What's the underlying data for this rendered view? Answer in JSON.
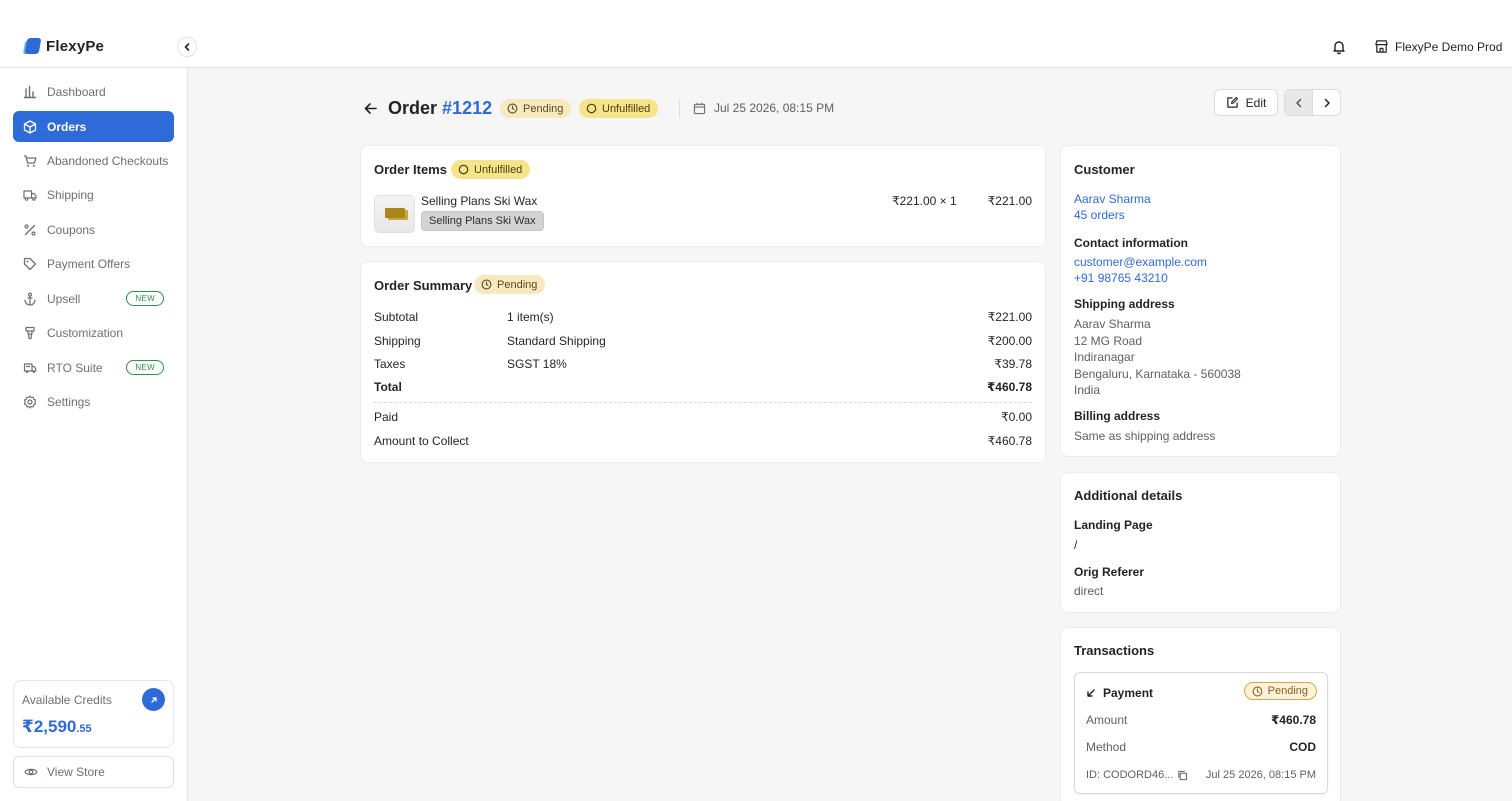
{
  "app": {
    "name": "FlexyPe",
    "store_name": "FlexyPe Demo Prod"
  },
  "sidebar": {
    "items": [
      {
        "label": "Dashboard",
        "icon": "bar-chart-icon"
      },
      {
        "label": "Orders",
        "icon": "box-icon",
        "active": true
      },
      {
        "label": "Abandoned Checkouts",
        "icon": "cart-icon"
      },
      {
        "label": "Shipping",
        "icon": "truck-icon"
      },
      {
        "label": "Coupons",
        "icon": "percent-icon"
      },
      {
        "label": "Payment Offers",
        "icon": "tag-icon"
      },
      {
        "label": "Upsell",
        "icon": "anchor-icon",
        "badge": "NEW"
      },
      {
        "label": "Customization",
        "icon": "cup-icon"
      },
      {
        "label": "RTO Suite",
        "icon": "rto-truck-icon",
        "badge": "NEW"
      },
      {
        "label": "Settings",
        "icon": "gear-icon"
      }
    ],
    "credits": {
      "label": "Available Credits",
      "amount": "₹2,590",
      "decimals": ".55"
    },
    "view_store": "View Store"
  },
  "order": {
    "prefix": "Order",
    "number": "#1212",
    "payment_status": "Pending",
    "fulfillment_status": "Unfulfilled",
    "date": "Jul 25 2026, 08:15 PM",
    "edit_label": "Edit"
  },
  "items_card": {
    "title": "Order Items",
    "status": "Unfulfilled",
    "items": [
      {
        "name": "Selling Plans Ski Wax",
        "variant": "Selling Plans Ski Wax",
        "unit": "₹221.00 × 1",
        "total": "₹221.00"
      }
    ]
  },
  "summary": {
    "title": "Order Summary",
    "status": "Pending",
    "rows": [
      {
        "label": "Subtotal",
        "detail": "1 item(s)",
        "amount": "₹221.00"
      },
      {
        "label": "Shipping",
        "detail": "Standard Shipping",
        "amount": "₹200.00"
      },
      {
        "label": "Taxes",
        "detail": "SGST 18%",
        "amount": "₹39.78"
      },
      {
        "label": "Total",
        "detail": "",
        "amount": "₹460.78"
      }
    ],
    "paid_label": "Paid",
    "paid": "₹0.00",
    "collect_label": "Amount to Collect",
    "collect": "₹460.78"
  },
  "customer": {
    "title": "Customer",
    "name": "Aarav Sharma",
    "orders": "45 orders",
    "contact_title": "Contact information",
    "email": "customer@example.com",
    "phone": "+91 98765 43210",
    "shipping_title": "Shipping address",
    "shipping_lines": [
      "Aarav Sharma",
      "12 MG Road",
      "Indiranagar",
      "Bengaluru, Karnataka - 560038",
      "India"
    ],
    "billing_title": "Billing address",
    "billing": "Same as shipping address"
  },
  "additional": {
    "title": "Additional details",
    "landing_label": "Landing Page",
    "landing": "/",
    "referer_label": "Orig Referer",
    "referer": "direct"
  },
  "transactions": {
    "title": "Transactions",
    "payment_label": "Payment",
    "status": "Pending",
    "amount_label": "Amount",
    "amount": "₹460.78",
    "method_label": "Method",
    "method": "COD",
    "id": "ID: CODORD46...",
    "date": "Jul 25 2026, 08:15 PM"
  },
  "colors": {
    "primary": "#2f6bd8",
    "pending_bg": "#f8e8bf",
    "unfulfilled_bg": "#f6e48a",
    "new_badge": "#2f8f4e"
  }
}
